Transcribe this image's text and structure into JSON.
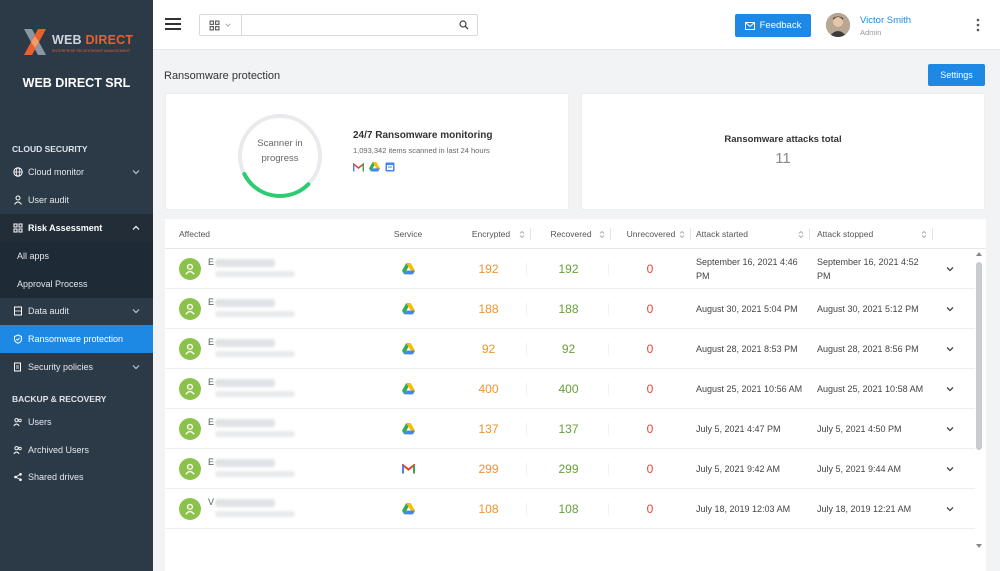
{
  "brand": {
    "logo_word1": "WEB",
    "logo_word2": "DIRECT",
    "logo_tagline": "ENTERPRISE RELATIONSHIP MANAGEMENT",
    "company": "WEB DIRECT SRL",
    "accent": "#e8612c"
  },
  "sidebar": {
    "cloud_security_heading": "CLOUD SECURITY",
    "cloud_monitor": "Cloud monitor",
    "user_audit": "User audit",
    "risk_assessment": "Risk Assessment",
    "all_apps": "All apps",
    "approval_process": "Approval Process",
    "data_audit": "Data audit",
    "ransomware_protection": "Ransomware protection",
    "security_policies": "Security policies",
    "backup_heading": "BACKUP & RECOVERY",
    "users": "Users",
    "archived_users": "Archived Users",
    "shared_drives": "Shared drives"
  },
  "topbar": {
    "search_value": "",
    "feedback": "Feedback",
    "user_name": "Victor Smith",
    "user_role": "Admin"
  },
  "page": {
    "title": "Ransomware protection",
    "settings": "Settings"
  },
  "scanner": {
    "status_line1": "Scanner in",
    "status_line2": "progress",
    "progress": 0.3,
    "monitor_title": "24/7 Ransomware monitoring",
    "monitor_sub": "1,093,342 items scanned in last 24 hours",
    "services": [
      "gmail-icon",
      "google-drive-icon",
      "google-calendar-icon"
    ]
  },
  "attacks": {
    "title": "Ransomware attacks total",
    "value": "11"
  },
  "table": {
    "headers": {
      "affected": "Affected",
      "service": "Service",
      "encrypted": "Encrypted",
      "recovered": "Recovered",
      "unrecovered": "Unrecovered",
      "started": "Attack started",
      "stopped": "Attack stopped"
    },
    "rows": [
      {
        "initial": "E",
        "service": "google-drive-icon",
        "encrypted": "192",
        "recovered": "192",
        "unrecovered": "0",
        "started": "September 16, 2021 4:46 PM",
        "stopped": "September 16, 2021 4:52 PM"
      },
      {
        "initial": "E",
        "service": "google-drive-icon",
        "encrypted": "188",
        "recovered": "188",
        "unrecovered": "0",
        "started": "August 30, 2021 5:04 PM",
        "stopped": "August 30, 2021 5:12 PM"
      },
      {
        "initial": "E",
        "service": "google-drive-icon",
        "encrypted": "92",
        "recovered": "92",
        "unrecovered": "0",
        "started": "August 28, 2021 8:53 PM",
        "stopped": "August 28, 2021 8:56 PM"
      },
      {
        "initial": "E",
        "service": "google-drive-icon",
        "encrypted": "400",
        "recovered": "400",
        "unrecovered": "0",
        "started": "August 25, 2021 10:56 AM",
        "stopped": "August 25, 2021 10:58 AM"
      },
      {
        "initial": "E",
        "service": "google-drive-icon",
        "encrypted": "137",
        "recovered": "137",
        "unrecovered": "0",
        "started": "July 5, 2021 4:47 PM",
        "stopped": "July 5, 2021 4:50 PM"
      },
      {
        "initial": "E",
        "service": "gmail-icon",
        "encrypted": "299",
        "recovered": "299",
        "unrecovered": "0",
        "started": "July 5, 2021 9:42 AM",
        "stopped": "July 5, 2021 9:44 AM"
      },
      {
        "initial": "V",
        "service": "google-drive-icon",
        "encrypted": "108",
        "recovered": "108",
        "unrecovered": "0",
        "started": "July 18, 2019 12:03 AM",
        "stopped": "July 18, 2019 12:21 AM"
      }
    ]
  },
  "colors": {
    "primary": "#1e88e5",
    "sidebar": "#2c3a47",
    "encrypted": "#f0932b",
    "recovered": "#689f38",
    "unrecovered": "#e8453c",
    "progress": "#2ecc71"
  }
}
